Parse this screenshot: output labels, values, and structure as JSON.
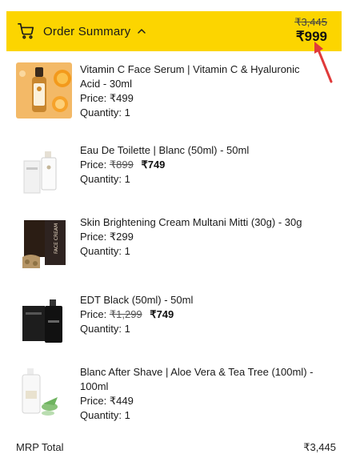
{
  "summary": {
    "label": "Order Summary",
    "mrp_total_struck": "₹3,445",
    "final_total": "₹999",
    "cart_icon": "cart-icon",
    "toggle_icon": "chevron-up-icon",
    "accent": "#fcd500",
    "annotation_color": "#e03a3a"
  },
  "items": [
    {
      "name": "Vitamin C Face Serum | Vitamin C & Hyaluronic Acid - 30ml",
      "price_label": "Price:",
      "price": "₹499",
      "quantity": "Quantity: 1"
    },
    {
      "name": "Eau De Toilette | Blanc (50ml) - 50ml",
      "price_label": "Price:",
      "price_old": "₹899",
      "price": "₹749",
      "quantity": "Quantity: 1"
    },
    {
      "name": "Skin Brightening Cream Multani Mitti (30g) - 30g",
      "price_label": "Price:",
      "price": "₹299",
      "quantity": "Quantity: 1",
      "tube_text": "FACE CREAM"
    },
    {
      "name": "EDT Black (50ml) - 50ml",
      "price_label": "Price:",
      "price_old": "₹1,299",
      "price": "₹749",
      "quantity": "Quantity: 1"
    },
    {
      "name": "Blanc After Shave | Aloe Vera & Tea Tree (100ml) - 100ml",
      "price_label": "Price:",
      "price": "₹449",
      "quantity": "Quantity: 1"
    }
  ],
  "totals": {
    "mrp_label": "MRP Total",
    "mrp_value": "₹3,445"
  }
}
